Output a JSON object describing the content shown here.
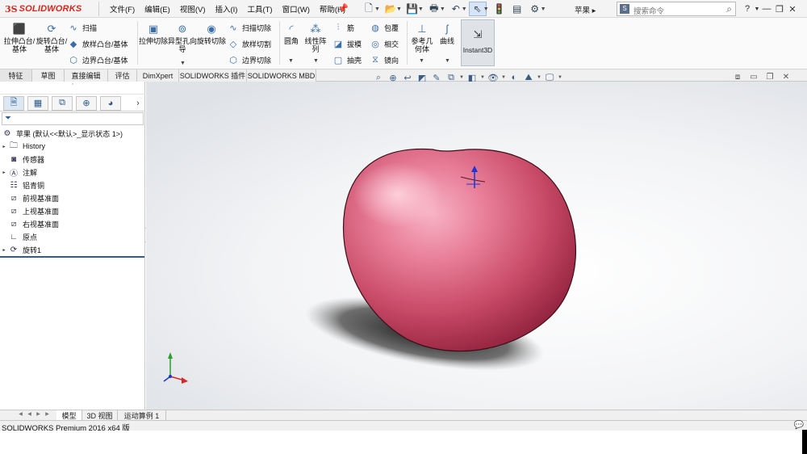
{
  "app": {
    "logo_ds": "3S",
    "logo_name": "SOLIDWORKS",
    "document_name": "苹果",
    "document_caret": "▸"
  },
  "menu": [
    "文件(F)",
    "编辑(E)",
    "视图(V)",
    "插入(I)",
    "工具(T)",
    "窗口(W)",
    "帮助(H)"
  ],
  "search": {
    "placeholder": "搜索命令"
  },
  "ribbon": {
    "extrude_boss": "拉伸凸台/基体",
    "revolve_boss": "旋转凸台/基体",
    "sweep": "扫描",
    "loft": "放样凸台/基体",
    "boundary": "边界凸台/基体",
    "extrude_cut": "拉伸切除",
    "hole_wizard": "异型孔向导",
    "revolve_cut": "旋转切除",
    "swept_cut": "扫描切除",
    "lofted_cut": "放样切割",
    "boundary_cut": "边界切除",
    "fillet": "圆角",
    "linear_pattern": "线性阵列",
    "rib": "筋",
    "draft": "拔模",
    "shell": "抽壳",
    "wrap": "包覆",
    "intersect": "相交",
    "mirror": "镜向",
    "ref_geometry": "参考几何体",
    "curves": "曲线",
    "instant3d": "Instant3D"
  },
  "tabs": [
    "特征",
    "草图",
    "直接编辑",
    "评估",
    "DimXpert",
    "SOLIDWORKS 插件",
    "SOLIDWORKS MBD"
  ],
  "tree": {
    "root": "苹果  (默认<<默认>_显示状态 1>)",
    "items": [
      "History",
      "传感器",
      "注解",
      "铝青铜",
      "前视基准面",
      "上视基准面",
      "右视基准面",
      "原点",
      "旋转1"
    ]
  },
  "bottom_tabs": [
    "模型",
    "3D 视图",
    "运动算例 1"
  ],
  "status": {
    "text": "SOLIDWORKS Premium 2016 x64 版"
  },
  "colors": {
    "accent": "#d9261c",
    "apple_body": "#d94b6b",
    "apple_light": "#f7a8bd"
  },
  "icons": {
    "triad_axes": [
      "x-axis",
      "y-axis",
      "z-axis"
    ]
  }
}
